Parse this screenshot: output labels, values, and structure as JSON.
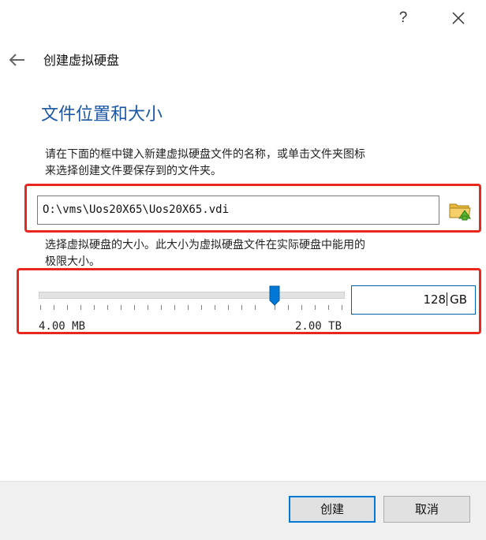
{
  "window": {
    "help_label": "?",
    "close_icon": "close-icon"
  },
  "header": {
    "back_icon": "arrow-left-icon",
    "title": "创建虚拟硬盘"
  },
  "section": {
    "title": "文件位置和大小"
  },
  "location": {
    "description": "请在下面的框中键入新建虚拟硬盘文件的名称，或单击文件夹图标\n来选择创建文件要保存到的文件夹。",
    "path_value": "O:\\vms\\Uos20X65\\Uos20X65.vdi",
    "folder_icon": "folder-icon"
  },
  "size": {
    "description": "选择虚拟硬盘的大小。此大小为虚拟硬盘文件在实际硬盘中能用的\n极限大小。",
    "slider_min_label": "4.00 MB",
    "slider_max_label": "2.00 TB",
    "value_number": "128",
    "value_unit": "GB"
  },
  "footer": {
    "create_label": "创建",
    "cancel_label": "取消"
  },
  "colors": {
    "accent": "#0078d7",
    "section_title": "#1d57a6",
    "highlight": "#e8281f"
  }
}
